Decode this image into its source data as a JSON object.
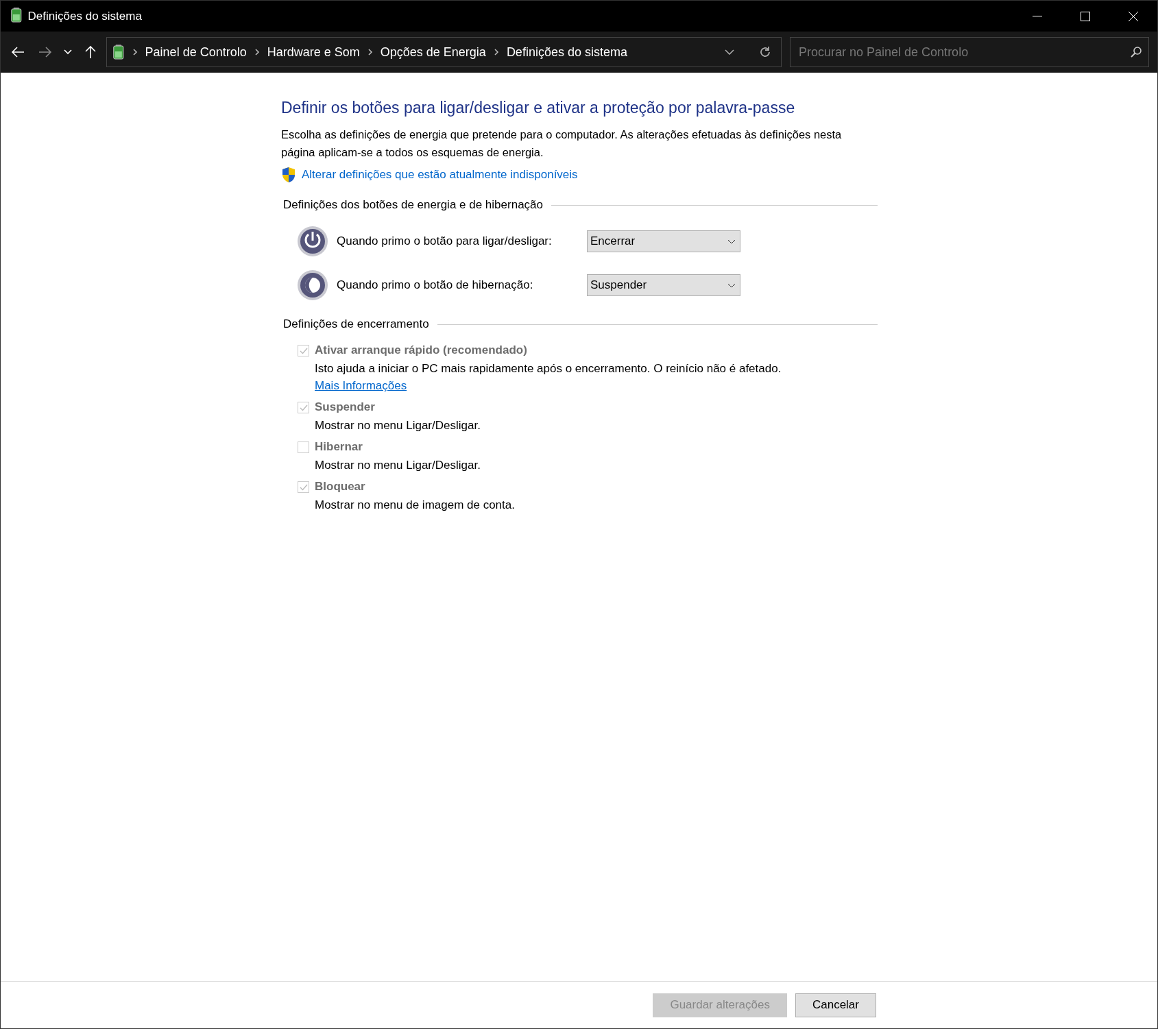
{
  "window": {
    "title": "Definições do sistema"
  },
  "address_bar": {
    "breadcrumbs": [
      "Painel de Controlo",
      "Hardware e Som",
      "Opções de Energia",
      "Definições do sistema"
    ]
  },
  "search": {
    "placeholder": "Procurar no Painel de Controlo"
  },
  "heading": "Definir os botões para ligar/desligar e ativar a proteção por palavra-passe",
  "intro": "Escolha as definições de energia que pretende para o computador. As alterações efetuadas às definições nesta página aplicam-se a todos os esquemas de energia.",
  "admin_link": "Alterar definições que estão atualmente indisponíveis",
  "button_section": {
    "title": "Definições dos botões de energia e de hibernação",
    "rows": [
      {
        "kind": "power",
        "label": "Quando primo o botão para ligar/desligar:",
        "value": "Encerrar"
      },
      {
        "kind": "sleep",
        "label": "Quando primo o botão de hibernação:",
        "value": "Suspender"
      }
    ]
  },
  "shutdown_section": {
    "title": "Definições de encerramento",
    "options": [
      {
        "label": "Ativar arranque rápido (recomendado)",
        "checked": true,
        "disabled": true,
        "description": "Isto ajuda a iniciar o PC mais rapidamente após o encerramento. O reinício não é afetado.",
        "link": "Mais Informações"
      },
      {
        "label": "Suspender",
        "checked": true,
        "disabled": true,
        "description": "Mostrar no menu Ligar/Desligar."
      },
      {
        "label": "Hibernar",
        "checked": false,
        "disabled": true,
        "description": "Mostrar no menu Ligar/Desligar."
      },
      {
        "label": "Bloquear",
        "checked": true,
        "disabled": true,
        "description": "Mostrar no menu de imagem de conta."
      }
    ]
  },
  "buttons": [
    {
      "label": "Guardar alterações",
      "disabled": true
    },
    {
      "label": "Cancelar",
      "disabled": false
    }
  ]
}
